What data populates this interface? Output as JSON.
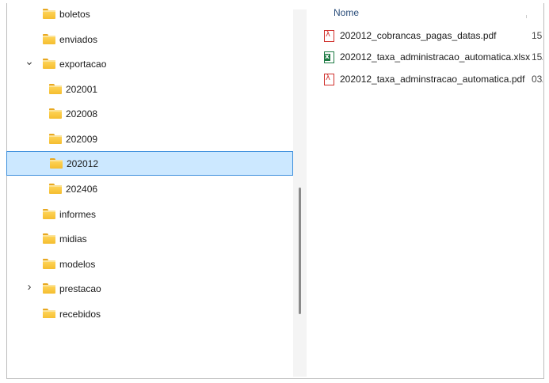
{
  "tree": {
    "items": [
      {
        "label": "boletos",
        "level": 1,
        "expander": "none",
        "selected": false
      },
      {
        "label": "enviados",
        "level": 1,
        "expander": "none",
        "selected": false
      },
      {
        "label": "exportacao",
        "level": 1,
        "expander": "expanded",
        "selected": false
      },
      {
        "label": "202001",
        "level": 2,
        "expander": "none",
        "selected": false
      },
      {
        "label": "202008",
        "level": 2,
        "expander": "none",
        "selected": false
      },
      {
        "label": "202009",
        "level": 2,
        "expander": "none",
        "selected": false
      },
      {
        "label": "202012",
        "level": 2,
        "expander": "none",
        "selected": true
      },
      {
        "label": "202406",
        "level": 2,
        "expander": "none",
        "selected": false
      },
      {
        "label": "informes",
        "level": 1,
        "expander": "none",
        "selected": false
      },
      {
        "label": "midias",
        "level": 1,
        "expander": "none",
        "selected": false
      },
      {
        "label": "modelos",
        "level": 1,
        "expander": "none",
        "selected": false
      },
      {
        "label": "prestacao",
        "level": 1,
        "expander": "collapsed",
        "selected": false
      },
      {
        "label": "recebidos",
        "level": 1,
        "expander": "none",
        "selected": false
      }
    ],
    "icons": {
      "folder": "folder-icon",
      "expanded": "chevron-down-icon",
      "collapsed": "chevron-right-icon"
    }
  },
  "file_list": {
    "column_name_header": "Nome",
    "files": [
      {
        "name": "202012_cobrancas_pagas_datas.pdf",
        "date": "15",
        "icon": "pdf-icon"
      },
      {
        "name": "202012_taxa_administracao_automatica.xlsx",
        "date": "15/",
        "icon": "excel-icon"
      },
      {
        "name": "202012_taxa_adminstracao_automatica.pdf",
        "date": "03/",
        "icon": "pdf-icon"
      }
    ]
  },
  "colors": {
    "selection_bg": "#cce8ff",
    "selection_border": "#3d8fdc",
    "pdf": "#d0312d",
    "excel": "#1d7a43",
    "folder": "#f5bd2f"
  }
}
